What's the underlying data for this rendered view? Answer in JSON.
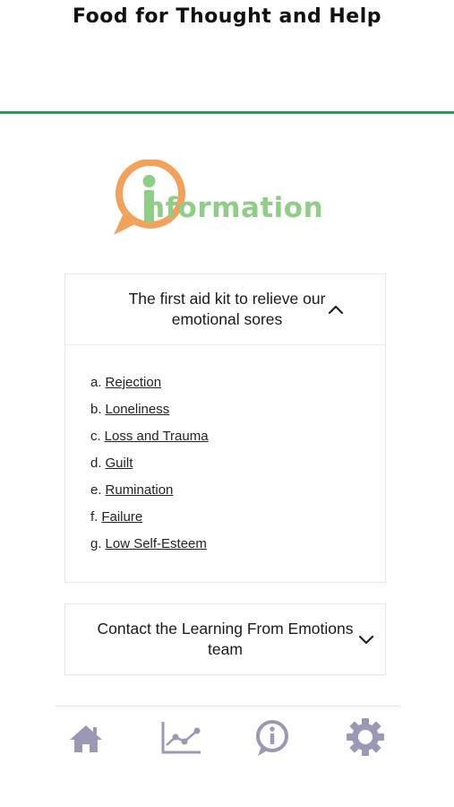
{
  "header": {
    "title": "Food for Thought and Help"
  },
  "logo": {
    "letter": "i",
    "word": "nformation"
  },
  "panels": [
    {
      "title": "The first aid kit to relieve our emotional sores",
      "expanded": true,
      "items": [
        {
          "label": "a.",
          "text": "Rejection"
        },
        {
          "label": "b.",
          "text": "Loneliness"
        },
        {
          "label": "c.",
          "text": "Loss and Trauma"
        },
        {
          "label": "d.",
          "text": "Guilt"
        },
        {
          "label": "e.",
          "text": "Rumination"
        },
        {
          "label": "f.",
          "text": "Failure"
        },
        {
          "label": "g.",
          "text": "Low Self-Esteem"
        }
      ]
    },
    {
      "title": "Contact the Learning From Emotions team",
      "expanded": false
    }
  ],
  "nav": {
    "items": [
      {
        "icon": "home-icon"
      },
      {
        "icon": "chart-icon"
      },
      {
        "icon": "info-icon"
      },
      {
        "icon": "gear-icon"
      }
    ],
    "color": "#9a99b5"
  },
  "colors": {
    "accent": "#2e9e55",
    "logo_green": "#8fce86",
    "logo_orange": "#f2a25a"
  }
}
